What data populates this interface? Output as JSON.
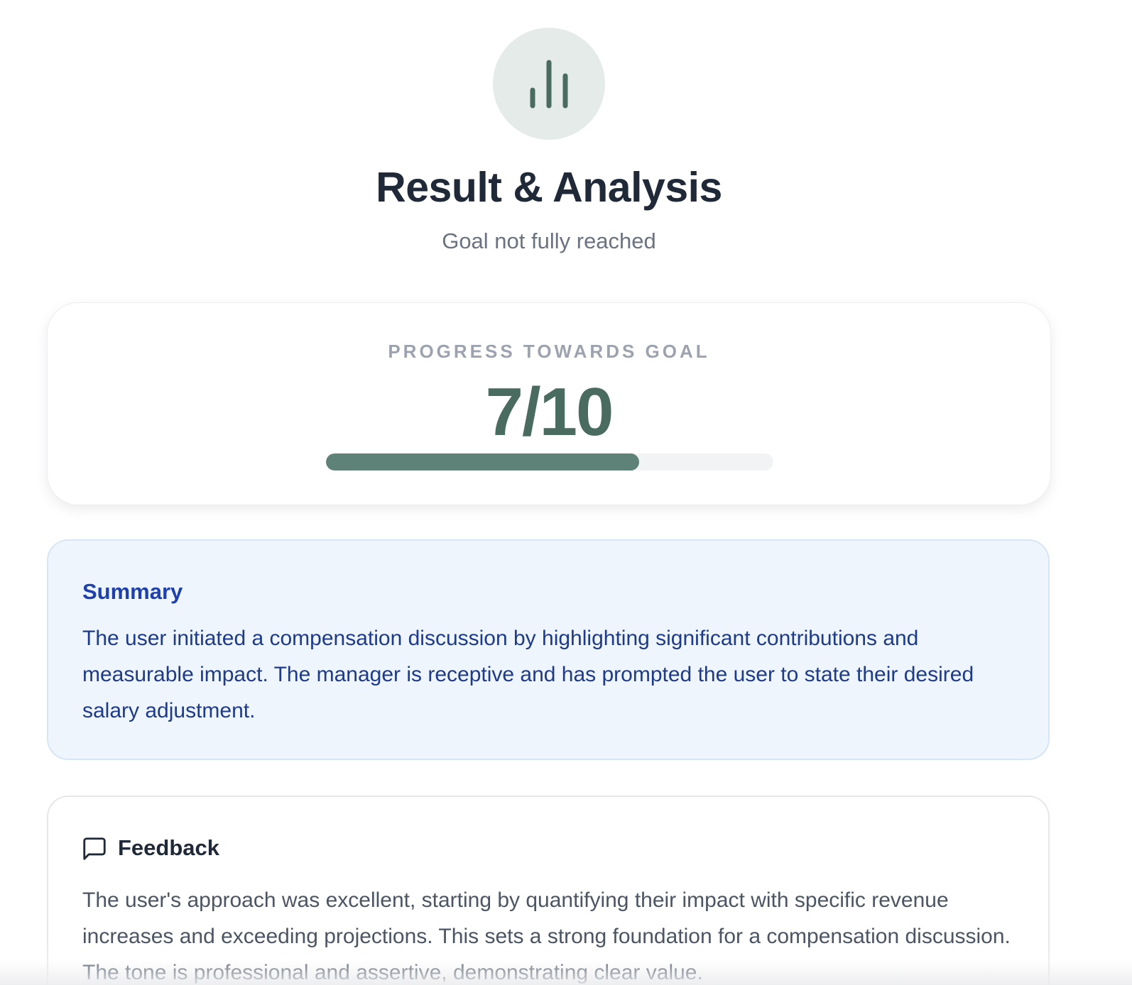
{
  "header": {
    "icon": "bar-chart-icon",
    "title": "Result & Analysis",
    "subtitle": "Goal not fully reached"
  },
  "progress": {
    "label": "PROGRESS TOWARDS GOAL",
    "score_text": "7/10",
    "value": 7,
    "max": 10,
    "fraction": 0.7,
    "fill_color": "#5e8277",
    "track_color": "#f1f3f5"
  },
  "summary": {
    "title": "Summary",
    "text": "The user initiated a compensation discussion by highlighting significant contributions and measurable impact. The manager is receptive and has prompted the user to state their desired salary adjustment."
  },
  "feedback": {
    "icon": "message-square-icon",
    "title": "Feedback",
    "text": "The user's approach was excellent, starting by quantifying their impact with specific revenue increases and exceeding projections. This sets a strong foundation for a compensation discussion. The tone is professional and assertive, demonstrating clear value."
  },
  "colors": {
    "accent": "#4a6b5f",
    "summary_bg": "#eef5fc",
    "summary_text": "#1e3a8a",
    "title_text": "#1f2937"
  }
}
